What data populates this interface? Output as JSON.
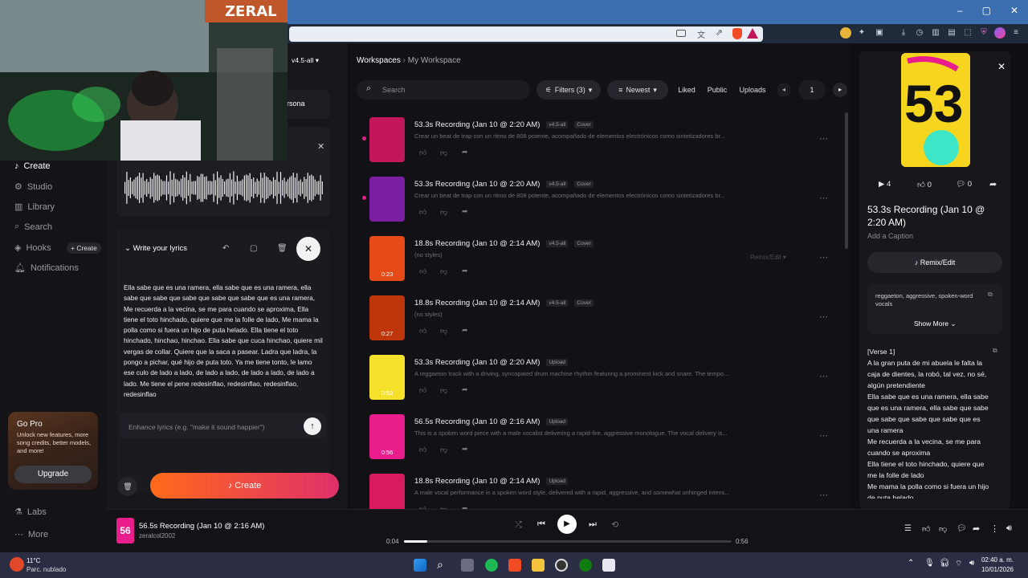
{
  "browser": {
    "window_controls": [
      "–",
      "▢",
      "✕"
    ]
  },
  "webcam": {
    "overlay_text": "ZERAL"
  },
  "sidebar": {
    "version_badge": "v4.5-all",
    "items": [
      {
        "label": "Create",
        "icon": "music-note-icon",
        "active": true
      },
      {
        "label": "Studio",
        "icon": "studio-icon"
      },
      {
        "label": "Library",
        "icon": "library-icon"
      },
      {
        "label": "Search",
        "icon": "search-icon"
      },
      {
        "label": "Hooks",
        "icon": "hooks-icon"
      },
      {
        "label": "Notifications",
        "icon": "bell-icon"
      }
    ],
    "hooks_create": "+ Create",
    "gopro": {
      "title": "Go Pro",
      "text": "Unlock new features, more song credits, better models, and more!",
      "button": "Upgrade"
    },
    "labs": "Labs",
    "more": "More"
  },
  "create_panel": {
    "persona_label": "rsona",
    "lyrics_header": "Write your lyrics",
    "lyrics": "Ella sabe que es una ramera, ella sabe que es una ramera, ella sabe que sabe que sabe que sabe que sabe que es una ramera, Me recuerda a la vecina, se me para cuando se aproxima, Ella tiene el toto hinchado, quiere que me la folle de lado, Me mama la polla como si fuera un hijo de puta helado. Ella tiene el toto hinchado, hinchao, hinchao. Ella sabe que cuca hinchao, quiere mil vergas de collar. Quiere que la saca a pasear. Ladra que ladra, la pongo a pichar, qué hijo de puta toto. Ya me tiene tonto, le lamo ese culo de lado a lado, de lado a lado, de lado a lado, de lado a lado. Me tiene el pene redesinflao, redesinflao, redesinflao, redesinflao",
    "enhance_placeholder": "Enhance lyrics (e.g. \"make it sound happier\")",
    "create_button": "Create"
  },
  "main": {
    "breadcrumb": {
      "root": "Workspaces",
      "current": "My Workspace"
    },
    "search_placeholder": "Search",
    "filters": "Filters (3)",
    "sort": "Newest",
    "liked": "Liked",
    "public": "Public",
    "uploads": "Uploads",
    "page": "1",
    "remix_ghost": "Remix/Edit",
    "songs": [
      {
        "title": "53.3s Recording (Jan 10 @ 2:20 AM)",
        "version": "v4.5-all",
        "tag": "Cover",
        "desc": "Crear un beat de trap con un ritmo de 808 potente, acompañado de elementos electrónicos como sintetizadores br...",
        "duration": "",
        "thumb_color": "#c2185b"
      },
      {
        "title": "53.3s Recording (Jan 10 @ 2:20 AM)",
        "version": "v4.5-all",
        "tag": "Cover",
        "desc": "Crear un beat de trap con un ritmo de 808 potente, acompañado de elementos electrónicos como sintetizadores br...",
        "duration": "",
        "thumb_color": "#7b1fa2"
      },
      {
        "title": "18.8s Recording (Jan 10 @ 2:14 AM)",
        "version": "v4.5-all",
        "tag": "Cover",
        "desc": "(no styles)",
        "duration": "0:23",
        "thumb_color": "#e64a19"
      },
      {
        "title": "18.8s Recording (Jan 10 @ 2:14 AM)",
        "version": "v4.5-all",
        "tag": "Cover",
        "desc": "(no styles)",
        "duration": "0:27",
        "thumb_color": "#bf360c"
      },
      {
        "title": "53.3s Recording (Jan 10 @ 2:20 AM)",
        "version": "",
        "tag": "Upload",
        "desc": "A reggaeton track with a driving, syncopated drum machine rhythm featuring a prominent kick and snare. The tempo...",
        "duration": "0:53",
        "thumb_color": "#f5e12a"
      },
      {
        "title": "56.5s Recording (Jan 10 @ 2:16 AM)",
        "version": "",
        "tag": "Upload",
        "desc": "This is a spoken word piece with a male vocalist delivering a rapid-fire, aggressive monologue. The vocal delivery is...",
        "duration": "0:56",
        "thumb_color": "#e91e8c"
      },
      {
        "title": "18.8s Recording (Jan 10 @ 2:14 AM)",
        "version": "",
        "tag": "Upload",
        "desc": "A male vocal performance in a spoken word style, delivered with a rapid, aggressive, and somewhat unhinged intens...",
        "duration": "",
        "thumb_color": "#d81b60"
      }
    ]
  },
  "right_panel": {
    "plays": "4",
    "likes": "0",
    "comments": "0",
    "title": "53.3s Recording (Jan 10 @ 2:20 AM)",
    "caption_placeholder": "Add a Caption",
    "remix_button": "Remix/Edit",
    "styles": "reggaeton, aggressive, spoken-word vocals",
    "show_more": "Show More",
    "lyrics": "[Verse 1]\nA la gran puta de mi abuela le falta la caja de dientes, la robó, tal vez, no sé, algún pretendiente\nElla sabe que es una ramera, ella sabe que es una ramera, ella sabe que sabe que sabe que sabe que sabe que es una ramera\nMe recuerda a la vecina, se me para cuando se aproxima\nElla tiene el toto hinchado, quiere que me la folle de lado\nMe mama la polla como si fuera un hijo de puta helado"
  },
  "player": {
    "title": "56.5s Recording (Jan 10 @ 2:16 AM)",
    "artist": "zeralcol2002",
    "current": "0:04",
    "total": "0:56",
    "progress": 0.07
  },
  "taskbar": {
    "weather_temp": "11°C",
    "weather_desc": "Parc. nublado",
    "time": "02:40 a. m.",
    "date": "10/01/2026"
  },
  "colors": {
    "accent_gradient_start": "#ff6a1a",
    "accent_gradient_end": "#e0306a",
    "background": "#121216"
  }
}
